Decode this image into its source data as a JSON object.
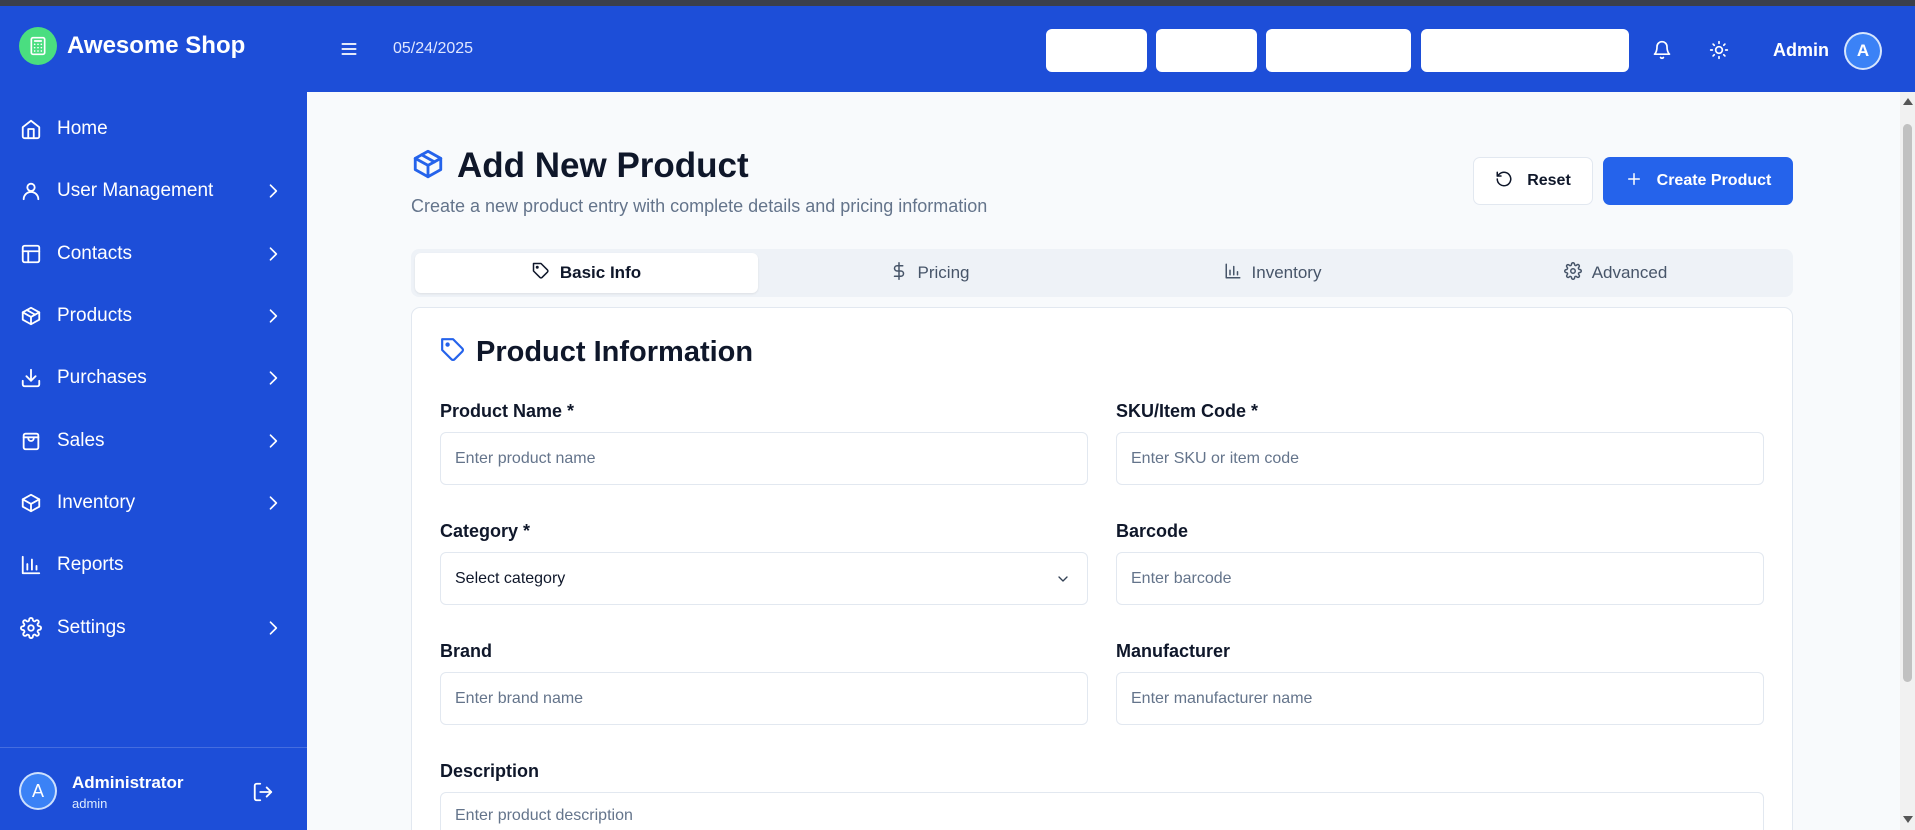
{
  "app": {
    "name": "Awesome Shop",
    "date": "05/24/2025"
  },
  "sidebar": {
    "items": [
      {
        "label": "Home",
        "icon": "home-icon",
        "chevron": false
      },
      {
        "label": "User Management",
        "icon": "user-icon",
        "chevron": true
      },
      {
        "label": "Contacts",
        "icon": "contacts-icon",
        "chevron": true
      },
      {
        "label": "Products",
        "icon": "box-icon",
        "chevron": true
      },
      {
        "label": "Purchases",
        "icon": "download-icon",
        "chevron": true
      },
      {
        "label": "Sales",
        "icon": "shopping-bag-icon",
        "chevron": true
      },
      {
        "label": "Inventory",
        "icon": "package-icon",
        "chevron": true
      },
      {
        "label": "Reports",
        "icon": "bar-chart-icon",
        "chevron": false
      },
      {
        "label": "Settings",
        "icon": "gear-icon",
        "chevron": true
      }
    ],
    "user": {
      "initial": "A",
      "name": "Administrator",
      "role": "admin"
    }
  },
  "header": {
    "user_name": "Admin",
    "user_initial": "A"
  },
  "page": {
    "title": "Add New Product",
    "subtitle": "Create a new product entry with complete details and pricing information",
    "reset_label": "Reset",
    "create_label": "Create Product"
  },
  "tabs": [
    {
      "label": "Basic Info",
      "icon": "tag-icon",
      "active": true
    },
    {
      "label": "Pricing",
      "icon": "dollar-icon",
      "active": false
    },
    {
      "label": "Inventory",
      "icon": "bar-chart-icon",
      "active": false
    },
    {
      "label": "Advanced",
      "icon": "gear-icon",
      "active": false
    }
  ],
  "form": {
    "section_title": "Product Information",
    "product_name": {
      "label": "Product Name *",
      "placeholder": "Enter product name"
    },
    "sku": {
      "label": "SKU/Item Code *",
      "placeholder": "Enter SKU or item code"
    },
    "category": {
      "label": "Category *",
      "value": "Select category"
    },
    "barcode": {
      "label": "Barcode",
      "placeholder": "Enter barcode"
    },
    "brand": {
      "label": "Brand",
      "placeholder": "Enter brand name"
    },
    "manufacturer": {
      "label": "Manufacturer",
      "placeholder": "Enter manufacturer name"
    },
    "description": {
      "label": "Description",
      "placeholder": "Enter product description"
    }
  },
  "colors": {
    "primary": "#1d4ed8",
    "accent": "#2563eb",
    "logo_bg": "#4ade80"
  }
}
